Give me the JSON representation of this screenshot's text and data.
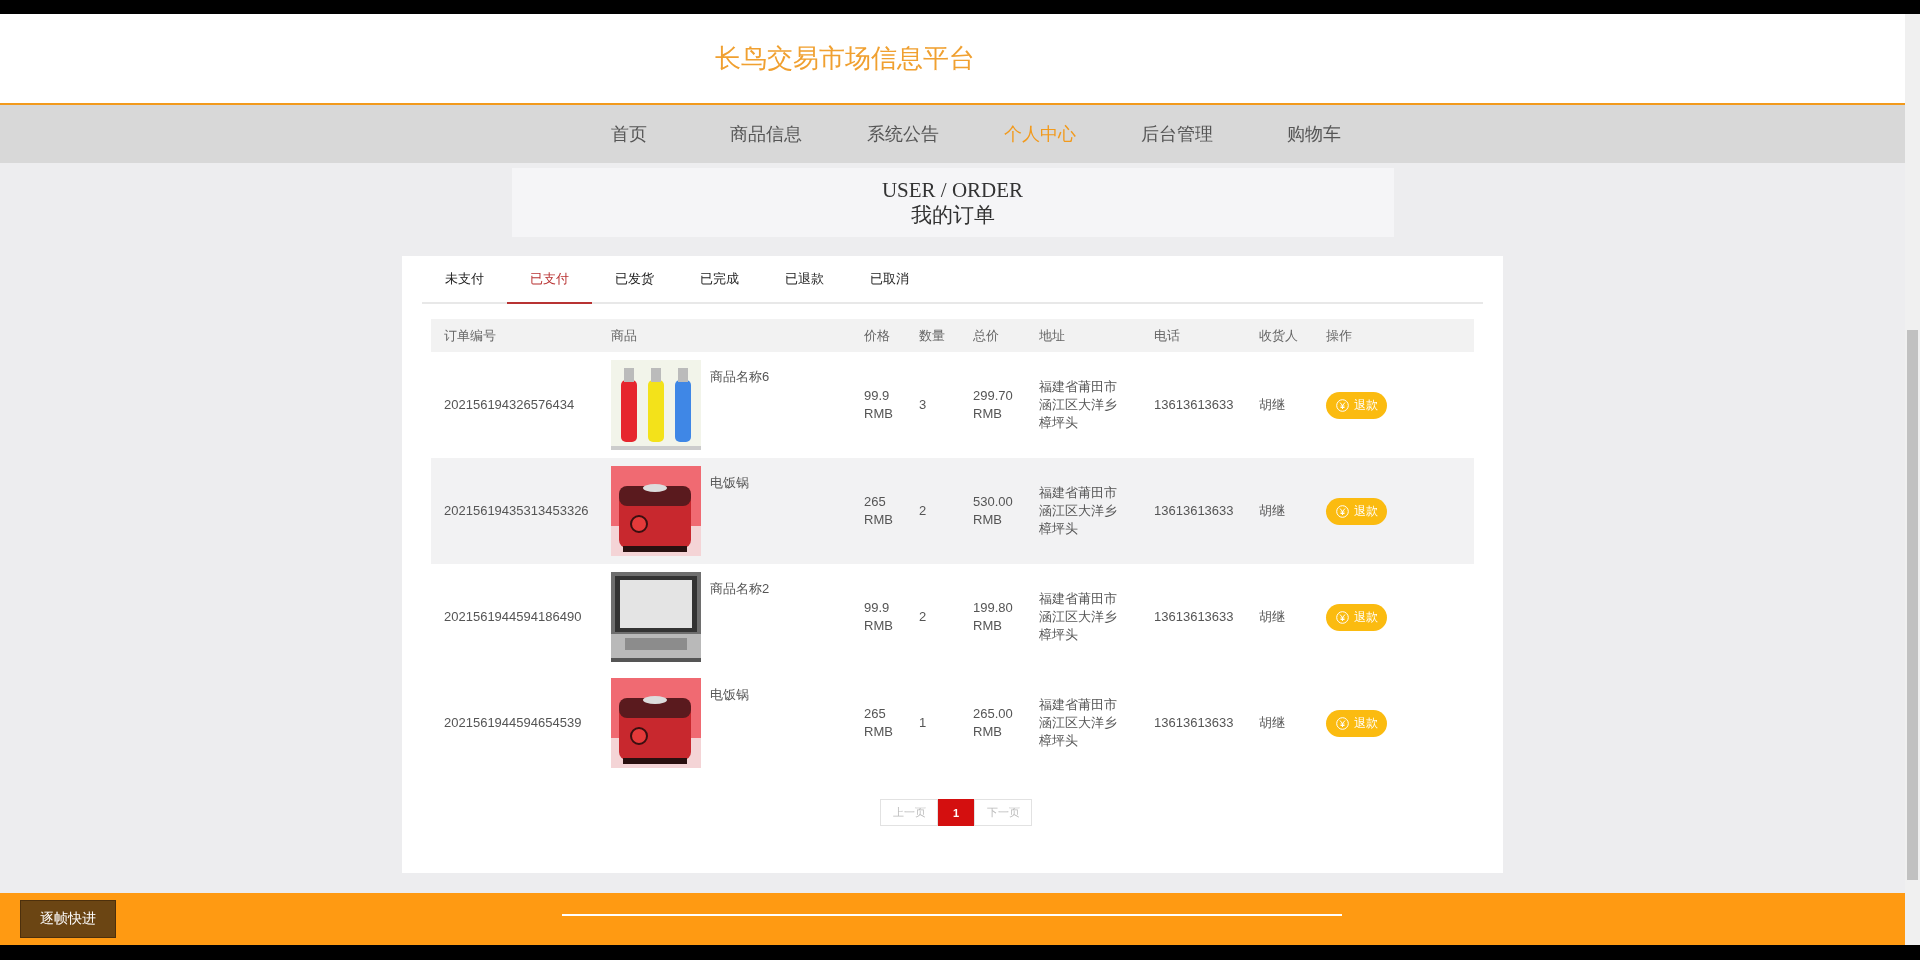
{
  "header": {
    "title": "长鸟交易市场信息平台"
  },
  "nav": [
    {
      "label": "首页",
      "selected": false
    },
    {
      "label": "商品信息",
      "selected": false
    },
    {
      "label": "系统公告",
      "selected": false
    },
    {
      "label": "个人中心",
      "selected": true
    },
    {
      "label": "后台管理",
      "selected": false
    },
    {
      "label": "购物车",
      "selected": false
    }
  ],
  "banner": {
    "title": "USER / ORDER",
    "subtitle": "我的订单"
  },
  "tabs": [
    {
      "label": "未支付",
      "selected": false
    },
    {
      "label": "已支付",
      "selected": true
    },
    {
      "label": "已发货",
      "selected": false
    },
    {
      "label": "已完成",
      "selected": false
    },
    {
      "label": "已退款",
      "selected": false
    },
    {
      "label": "已取消",
      "selected": false
    }
  ],
  "table": {
    "columns": [
      "订单编号",
      "商品",
      "价格",
      "数量",
      "总价",
      "地址",
      "电话",
      "收货人",
      "操作"
    ],
    "rows": [
      {
        "order_no": "202156194326576434",
        "product": {
          "name": "商品名称6"
        },
        "price": "99.9 RMB",
        "quantity": "3",
        "total": "299.70 RMB",
        "address": "福建省莆田市涵江区大洋乡樟坪头",
        "phone": "13613613633",
        "receiver": "胡继",
        "action": "退款",
        "hovered": false
      },
      {
        "order_no": "20215619435313453326",
        "product": {
          "name": "电饭锅"
        },
        "price": "265 RMB",
        "quantity": "2",
        "total": "530.00 RMB",
        "address": "福建省莆田市涵江区大洋乡樟坪头",
        "phone": "13613613633",
        "receiver": "胡继",
        "action": "退款",
        "hovered": true
      },
      {
        "order_no": "2021561944594186490",
        "product": {
          "name": "商品名称2"
        },
        "price": "99.9 RMB",
        "quantity": "2",
        "total": "199.80 RMB",
        "address": "福建省莆田市涵江区大洋乡樟坪头",
        "phone": "13613613633",
        "receiver": "胡继",
        "action": "退款",
        "hovered": false
      },
      {
        "order_no": "2021561944594654539",
        "product": {
          "name": "电饭锅"
        },
        "price": "265 RMB",
        "quantity": "1",
        "total": "265.00 RMB",
        "address": "福建省莆田市涵江区大洋乡樟坪头",
        "phone": "13613613633",
        "receiver": "胡继",
        "action": "退款",
        "hovered": false
      }
    ]
  },
  "pagination": {
    "prev": {
      "label": "上一页",
      "disabled": true
    },
    "pages": [
      {
        "label": "1",
        "selected": true
      }
    ],
    "next": {
      "label": "下一页",
      "disabled": true
    }
  },
  "player_bar": {
    "button": "逐帧快进"
  }
}
